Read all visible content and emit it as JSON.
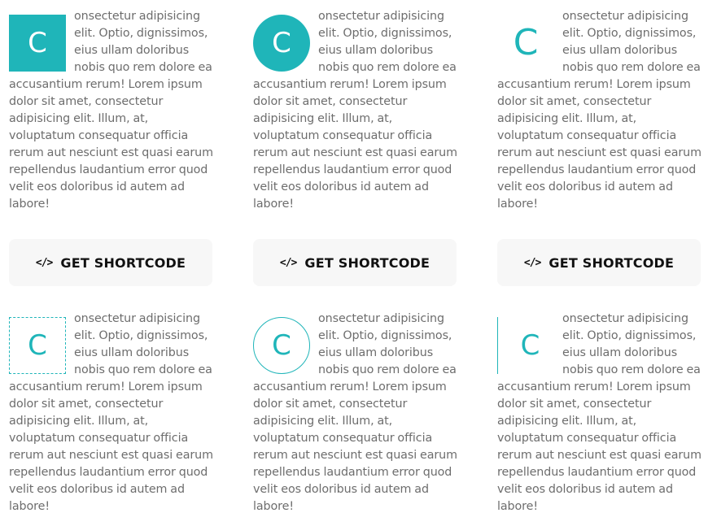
{
  "accent_color": "#1fb5b9",
  "drop_cap_letter": "C",
  "paragraph_text": "onsectetur adipisicing elit. Optio, dignissimos, eius ullam doloribus nobis quo rem dolore ea accusantium rerum! Lorem ipsum dolor sit amet, consectetur adipisicing elit. Illum, at, voluptatum consequatur officia rerum aut nesciunt est quasi earum repellendus laudantium error quod velit eos doloribus id autem ad labore!",
  "buttons": {
    "label": "GET SHORTCODE",
    "icon": "code-icon",
    "icon_glyph": "</>"
  }
}
